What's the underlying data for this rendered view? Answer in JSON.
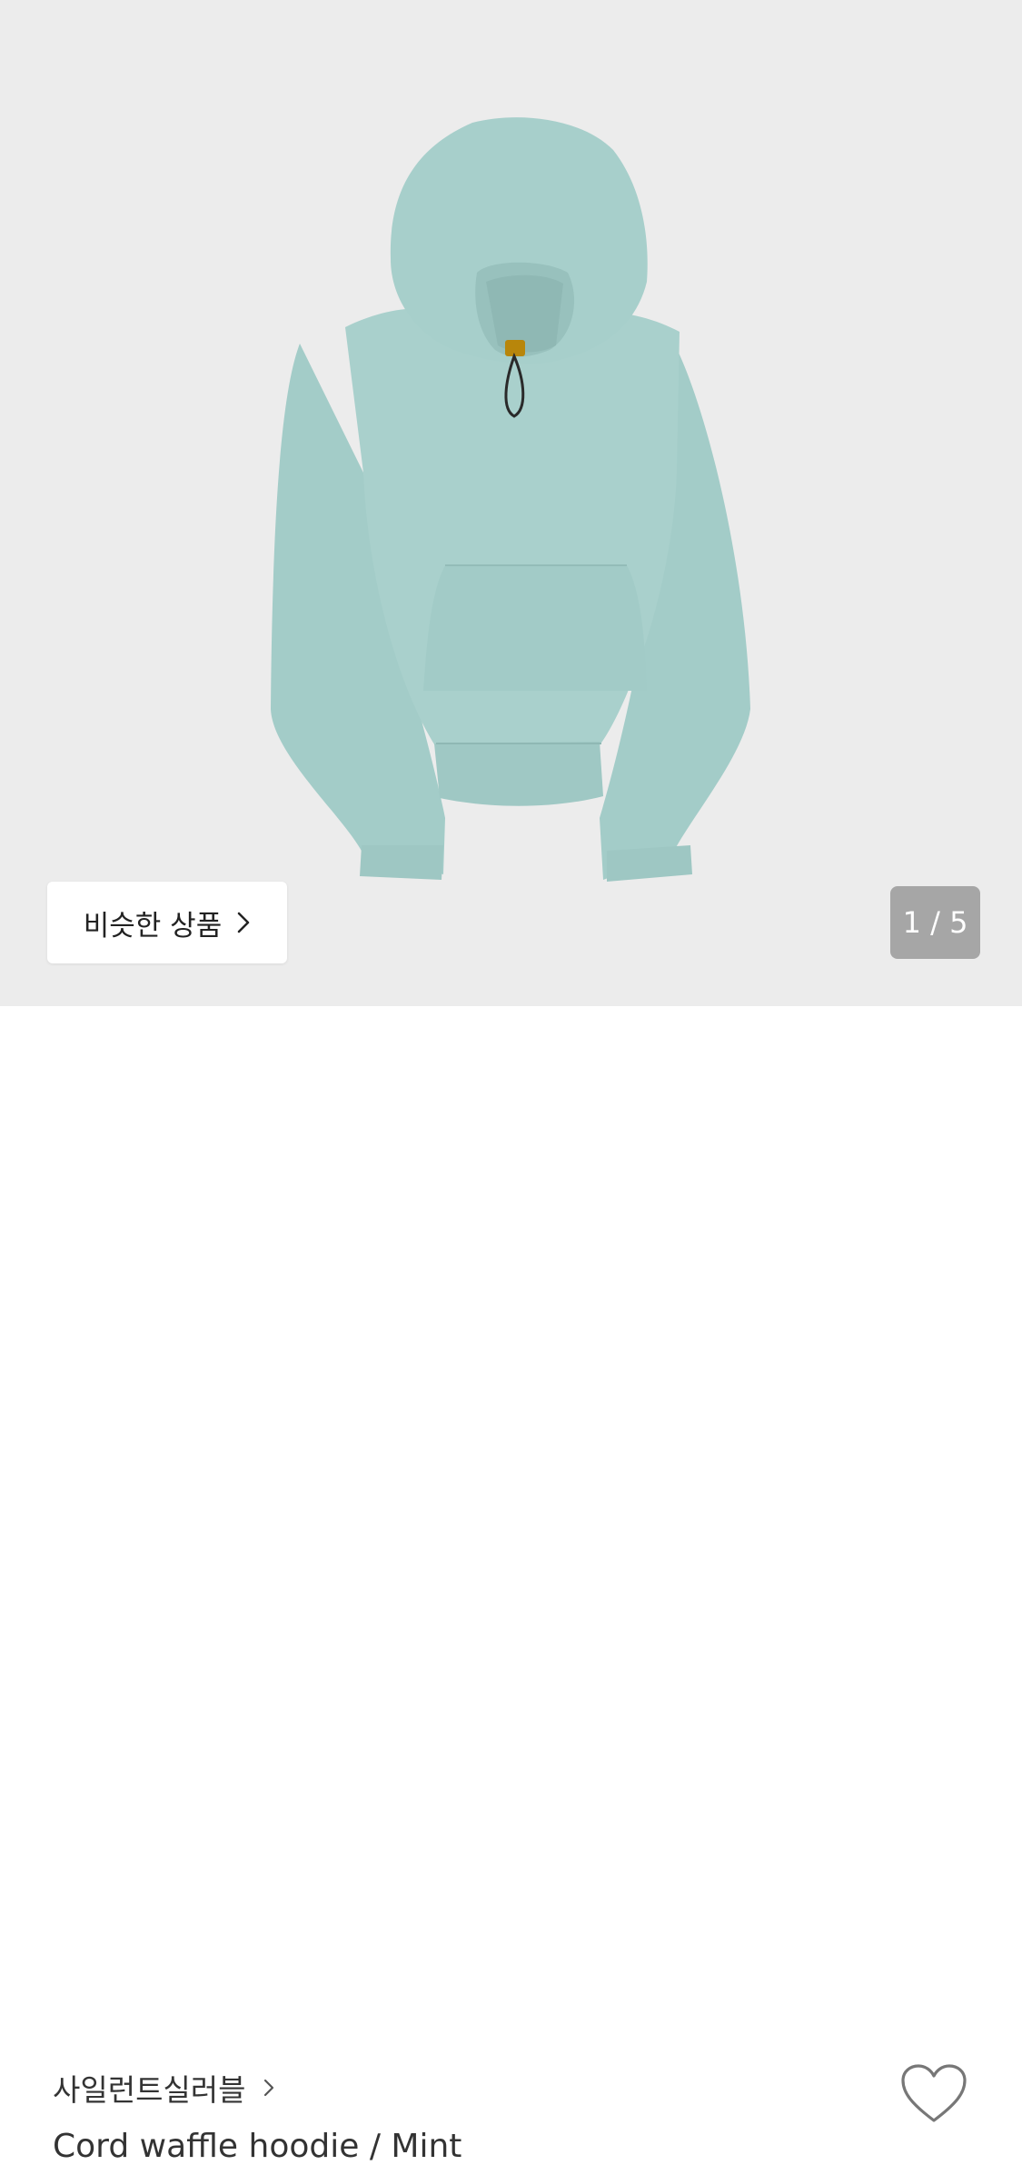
{
  "gallery": {
    "image_alt": "Cord waffle hoodie / Mint",
    "similar_button_label": "비슷한 상품",
    "page_indicator": "1 / 5",
    "garment_color": "#a9d0cc"
  },
  "product": {
    "brand": "사일런트실러블",
    "name": "Cord waffle hoodie / Mint"
  },
  "icons": {
    "similar_chevron": "chevron-right-icon",
    "brand_chevron": "chevron-right-icon",
    "wishlist": "heart-outline-icon"
  }
}
